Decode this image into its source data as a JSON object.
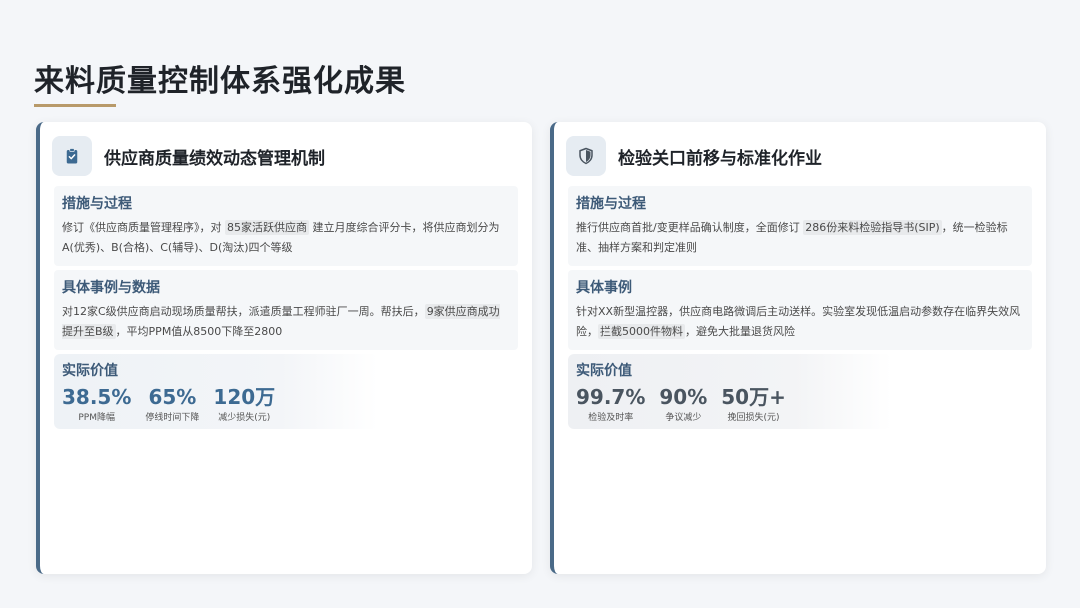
{
  "page": {
    "title": "来料质量控制体系强化成果"
  },
  "cards": [
    {
      "title": "供应商质量绩效动态管理机制",
      "icon": "clipboard-check-icon",
      "sections": {
        "measures": {
          "title": "措施与过程",
          "t1": "修订《供应商质量管理程序》，对 ",
          "h1": "85家活跃供应商",
          "t2": " 建立月度综合评分卡，将供应商划分为A(优秀)、B(合格)、C(辅导)、D(淘汰)四个等级"
        },
        "cases": {
          "title": "具体事例与数据",
          "t1": "对12家C级供应商启动现场质量帮扶，派遣质量工程师驻厂一周。帮扶后，",
          "h1": "9家供应商成功提升至B级",
          "t2": "，平均PPM值从8500下降至2800"
        },
        "value": {
          "title": "实际价值",
          "metrics": [
            {
              "value": "38.5%",
              "label": "PPM降幅"
            },
            {
              "value": "65%",
              "label": "停线时间下降"
            },
            {
              "value": "120万",
              "label": "减少损失(元)"
            }
          ]
        }
      }
    },
    {
      "title": "检验关口前移与标准化作业",
      "icon": "shield-icon",
      "sections": {
        "measures": {
          "title": "措施与过程",
          "t1": "推行供应商首批/变更样品确认制度，全面修订 ",
          "h1": "286份来料检验指导书(SIP)",
          "t2": "，统一检验标准、抽样方案和判定准则"
        },
        "cases": {
          "title": "具体事例",
          "t1": "针对XX新型温控器，供应商电路微调后主动送样。实验室发现低温启动参数存在临界失效风险，",
          "h1": "拦截5000件物料",
          "t2": "，避免大批量退货风险"
        },
        "value": {
          "title": "实际价值",
          "metrics": [
            {
              "value": "99.7%",
              "label": "检验及时率"
            },
            {
              "value": "90%",
              "label": "争议减少"
            },
            {
              "value": "50万+",
              "label": "挽回损失(元)"
            }
          ]
        }
      }
    }
  ]
}
